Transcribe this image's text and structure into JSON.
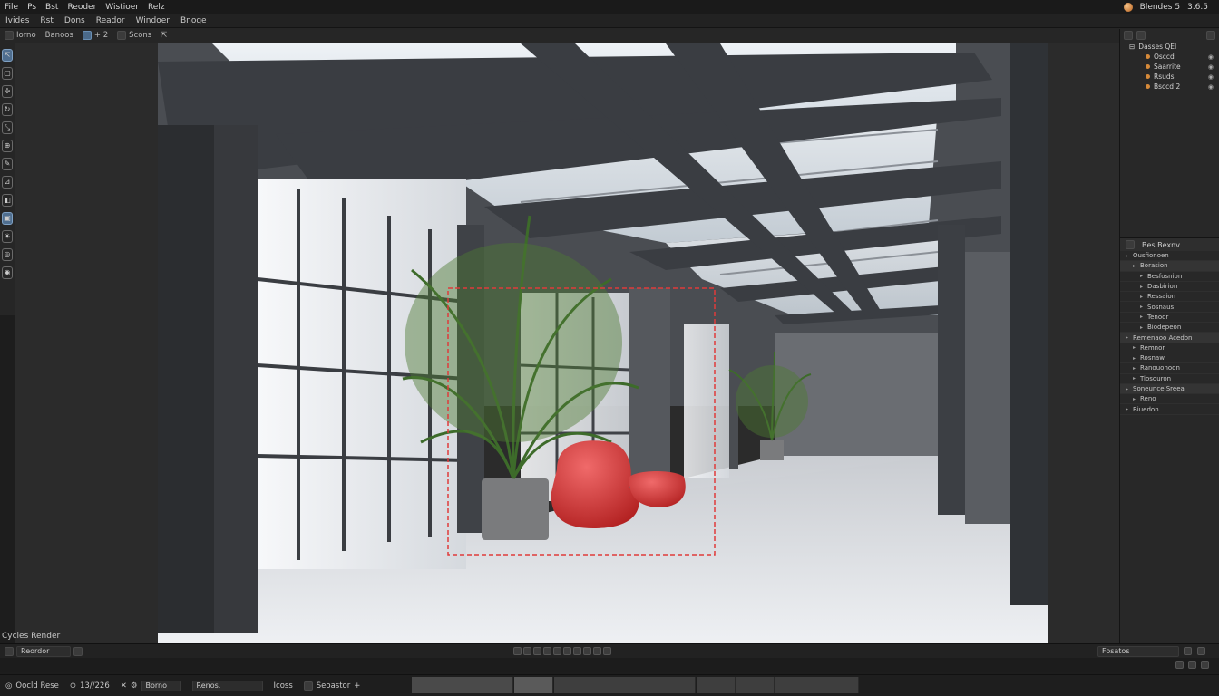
{
  "menu": [
    "File",
    "Ps",
    "Bst",
    "Reoder",
    "Wistioer",
    "Relz"
  ],
  "app_info": {
    "name": "Blendes 5",
    "version": "3.6.5"
  },
  "editor_menu": [
    "Ivides",
    "Rst",
    "Dons",
    "Reador",
    "Windoer",
    "Bnoge"
  ],
  "toolbar": {
    "item1": "Iorno",
    "item2": "Banoos",
    "item3": "+ 2",
    "item4": "Scons"
  },
  "left_tools": [
    "cursor",
    "box",
    "move",
    "rotate",
    "scale",
    "transform",
    "annotate",
    "measure",
    "add",
    "camera",
    "light",
    "world",
    "render"
  ],
  "viewport_label": "Cycles Render",
  "outliner": {
    "title": "Dasses QEI",
    "rows": [
      "Osccd",
      "Saarrite",
      "Rsuds",
      "Bsccd 2"
    ]
  },
  "properties": {
    "title": "Bes Bexnv",
    "rows": [
      "Ousfionoen",
      "Borasion",
      "Besfosnion",
      "Dasbirion",
      "Ressaion",
      "Sosnaus",
      "Tenoor",
      "Biodepeon",
      "Remenaoo Acedon",
      "Remnor",
      "Rosnaw",
      "Ranouonoon",
      "Tiosouron",
      "Soneunce Sreea",
      "Reno",
      "Biuedon"
    ]
  },
  "timeline": {
    "left_field": "Reordor",
    "right_field": "Fosatos"
  },
  "status": {
    "mode": "Oocld Rese",
    "frame": "13//226",
    "field1": "Borno",
    "field2": "Renos.",
    "label3": "Icoss",
    "label4": "Seoastor"
  },
  "colors": {
    "accent": "#4f6e8f",
    "selection": "#e03b3b",
    "bg": "#1d1d1d"
  }
}
